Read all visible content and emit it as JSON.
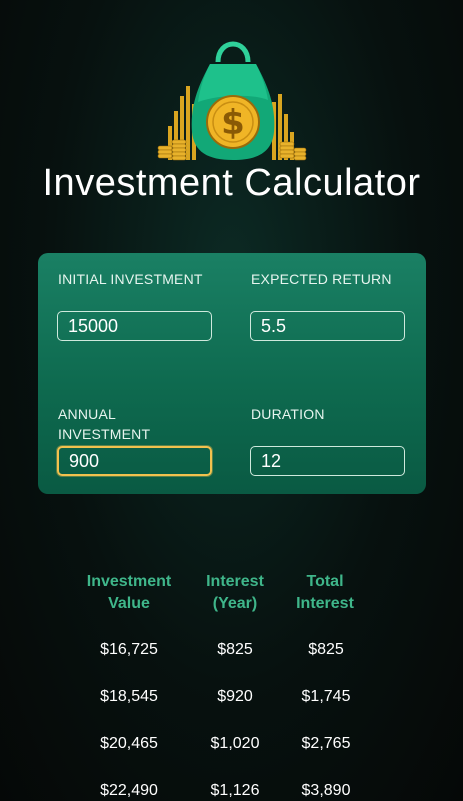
{
  "header": {
    "title": "Investment Calculator",
    "logo_icon": "money-bag-icon"
  },
  "form": {
    "initial_investment": {
      "label": "INITIAL INVESTMENT",
      "value": "15000"
    },
    "expected_return": {
      "label": "EXPECTED RETURN",
      "value": "5.5"
    },
    "annual_investment": {
      "label": "ANNUAL INVESTMENT",
      "value": "900"
    },
    "duration": {
      "label": "DURATION",
      "value": "12"
    }
  },
  "results": {
    "columns": [
      "Investment Value",
      "Interest (Year)",
      "Total Interest"
    ],
    "rows": [
      [
        "$16,725",
        "$825",
        "$825"
      ],
      [
        "$18,545",
        "$920",
        "$1,745"
      ],
      [
        "$20,465",
        "$1,020",
        "$2,765"
      ],
      [
        "$22,490",
        "$1,126",
        "$3,890"
      ]
    ]
  },
  "colors": {
    "accent": "#3fb68a",
    "card": "#137356",
    "focus": "#f2c14e"
  }
}
